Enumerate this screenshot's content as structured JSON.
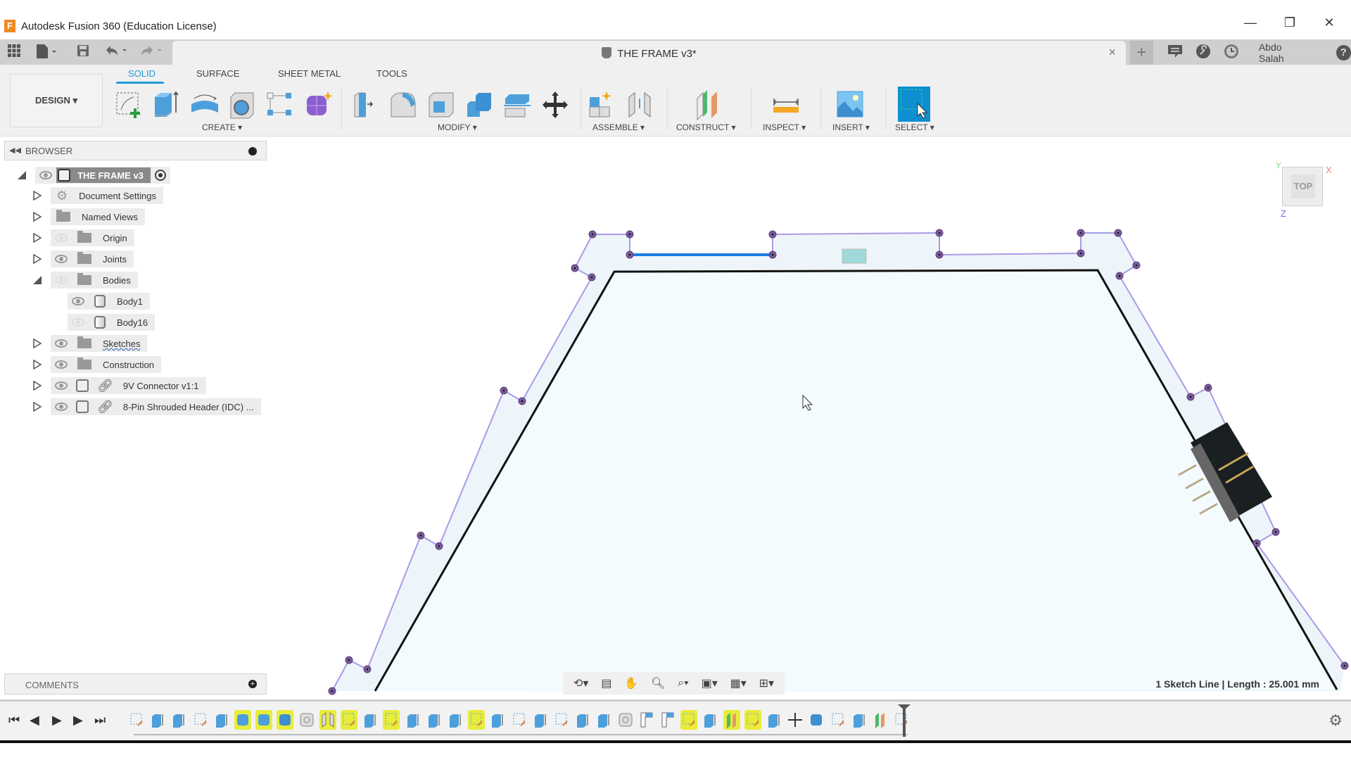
{
  "window": {
    "title": "Autodesk Fusion 360 (Education License)",
    "logo_letter": "F",
    "minimize_glyph": "—",
    "restore_glyph": "❐",
    "close_glyph": "✕"
  },
  "quick_access": {
    "document_tab": "THE FRAME v3*",
    "close_tab_glyph": "×",
    "new_tab_glyph": "+",
    "user_name": "Abdo Salah",
    "help_glyph": "?"
  },
  "toolbar": {
    "workspace_button": "DESIGN ▾",
    "workspace_tabs": [
      "SOLID",
      "SURFACE",
      "SHEET METAL",
      "TOOLS"
    ],
    "active_tab": "SOLID",
    "groups": [
      {
        "label": "CREATE ▾",
        "tools": [
          "create-sketch",
          "extrude",
          "revolve",
          "hole",
          "rectangular-pattern",
          "create-form"
        ]
      },
      {
        "label": "MODIFY ▾",
        "tools": [
          "press-pull",
          "fillet",
          "shell",
          "combine",
          "offset-face",
          "move-copy"
        ]
      },
      {
        "label": "ASSEMBLE ▾",
        "tools": [
          "new-component",
          "joint"
        ]
      },
      {
        "label": "CONSTRUCT ▾",
        "tools": [
          "offset-plane"
        ]
      },
      {
        "label": "INSPECT ▾",
        "tools": [
          "measure"
        ]
      },
      {
        "label": "INSERT ▾",
        "tools": [
          "insert-canvas"
        ]
      },
      {
        "label": "SELECT ▾",
        "tools": [
          "select"
        ]
      }
    ],
    "accent": "#1f9bd8"
  },
  "browser": {
    "title": "BROWSER",
    "root": "THE FRAME v3",
    "items": [
      {
        "label": "Document Settings",
        "icon": "gear-icon",
        "visible": null,
        "expanded": false,
        "indent": 1
      },
      {
        "label": "Named Views",
        "icon": "folder-icon",
        "visible": null,
        "expanded": false,
        "indent": 1
      },
      {
        "label": "Origin",
        "icon": "folder-icon",
        "visible": false,
        "expanded": false,
        "indent": 1
      },
      {
        "label": "Joints",
        "icon": "folder-icon",
        "visible": true,
        "expanded": false,
        "indent": 1
      },
      {
        "label": "Bodies",
        "icon": "folder-icon",
        "visible": false,
        "expanded": true,
        "indent": 1
      },
      {
        "label": "Body1",
        "icon": "body-icon",
        "visible": true,
        "expanded": null,
        "indent": 2
      },
      {
        "label": "Body16",
        "icon": "body-icon",
        "visible": false,
        "expanded": null,
        "indent": 2
      },
      {
        "label": "Sketches",
        "icon": "folder-icon",
        "visible": true,
        "expanded": false,
        "indent": 1
      },
      {
        "label": "Construction",
        "icon": "folder-icon",
        "visible": true,
        "expanded": false,
        "indent": 1
      },
      {
        "label": "9V Connector v1:1",
        "icon": "component-icon",
        "visible": true,
        "expanded": false,
        "indent": 1,
        "linked": true
      },
      {
        "label": "8-Pin Shrouded Header (IDC) ...",
        "icon": "component-icon",
        "visible": true,
        "expanded": false,
        "indent": 1,
        "linked": true
      }
    ]
  },
  "comments": {
    "title": "COMMENTS"
  },
  "viewcube": {
    "face": "TOP",
    "axis_x": "X",
    "axis_y": "Y",
    "axis_z": "Z"
  },
  "status": {
    "text": "1 Sketch Line | Length : 25.001 mm"
  },
  "nav_bar": {
    "tools": [
      "orbit-icon",
      "look-at-icon",
      "pan-icon",
      "zoom-icon",
      "fit-icon",
      "display-settings-icon",
      "grid-icon",
      "viewports-icon"
    ]
  },
  "timeline": {
    "controls": [
      "⏮",
      "◀",
      "▶",
      "▶",
      "⏭"
    ],
    "features": [
      {
        "type": "sketch",
        "hl": false
      },
      {
        "type": "extrude",
        "hl": false
      },
      {
        "type": "extrude",
        "hl": false
      },
      {
        "type": "sketch",
        "hl": false
      },
      {
        "type": "extrude",
        "hl": false
      },
      {
        "type": "fillet",
        "hl": true
      },
      {
        "type": "pattern",
        "hl": true
      },
      {
        "type": "combine",
        "hl": true
      },
      {
        "type": "joint-origin",
        "hl": false
      },
      {
        "type": "joint",
        "hl": true
      },
      {
        "type": "sketch",
        "hl": true
      },
      {
        "type": "extrude",
        "hl": false
      },
      {
        "type": "sketch",
        "hl": true
      },
      {
        "type": "extrude",
        "hl": false
      },
      {
        "type": "extrude",
        "hl": false
      },
      {
        "type": "extrude",
        "hl": false
      },
      {
        "type": "sketch",
        "hl": true
      },
      {
        "type": "extrude",
        "hl": false
      },
      {
        "type": "sketch",
        "hl": false
      },
      {
        "type": "extrude",
        "hl": false
      },
      {
        "type": "sketch",
        "hl": false
      },
      {
        "type": "extrude",
        "hl": false
      },
      {
        "type": "extrude",
        "hl": false
      },
      {
        "type": "joint-origin",
        "hl": false
      },
      {
        "type": "component",
        "hl": false
      },
      {
        "type": "component",
        "hl": false
      },
      {
        "type": "sketch",
        "hl": true
      },
      {
        "type": "extrude",
        "hl": false
      },
      {
        "type": "plane",
        "hl": true
      },
      {
        "type": "sketch",
        "hl": true
      },
      {
        "type": "extrude",
        "hl": false
      },
      {
        "type": "move",
        "hl": false
      },
      {
        "type": "combine",
        "hl": false
      },
      {
        "type": "sketch",
        "hl": false
      },
      {
        "type": "extrude",
        "hl": false
      },
      {
        "type": "plane",
        "hl": false
      },
      {
        "type": "sketch",
        "hl": false
      }
    ]
  }
}
